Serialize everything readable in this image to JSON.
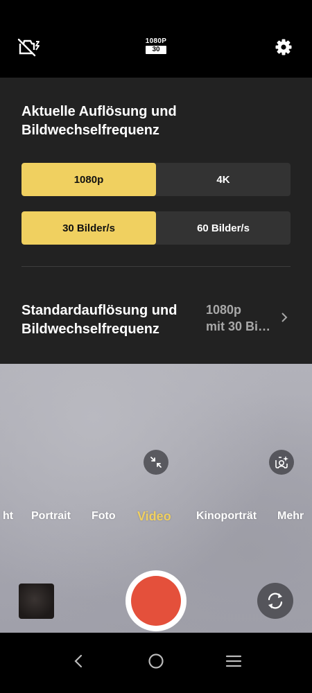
{
  "topbar": {
    "flash_icon": "flash-off-icon",
    "resolution_badge": {
      "resolution": "1080P",
      "fps": "30"
    },
    "settings_icon": "gear-icon"
  },
  "panel": {
    "title": "Aktuelle Auflösung und Bildwechselfrequenz",
    "resolution_options": [
      {
        "label": "1080p",
        "selected": true
      },
      {
        "label": "4K",
        "selected": false
      }
    ],
    "fps_options": [
      {
        "label": "30 Bilder/s",
        "selected": true
      },
      {
        "label": "60 Bilder/s",
        "selected": false
      }
    ],
    "default_setting": {
      "label": "Standardauflösung und Bildwechselfrequenz",
      "value_line1": "1080p",
      "value_line2": "mit 30 Bi…"
    }
  },
  "camera": {
    "modes": [
      "ht",
      "Portrait",
      "Foto",
      "Video",
      "Kinoporträt",
      "Mehr"
    ],
    "active_mode": "Video"
  },
  "colors": {
    "accent": "#f0d060",
    "shutter": "#e4503b",
    "panel_bg": "#222222",
    "segment_bg": "#333333"
  }
}
